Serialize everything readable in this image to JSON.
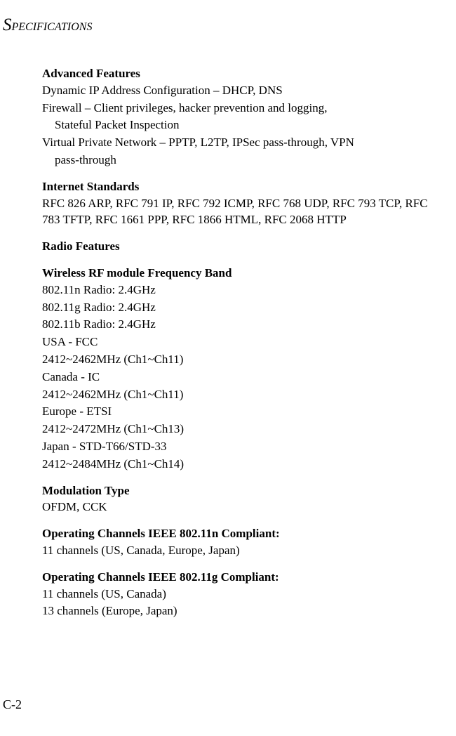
{
  "header": "PECIFICATIONS",
  "header_first": "S",
  "page_number": "C-2",
  "sections": {
    "advanced_features": {
      "heading": "Advanced Features",
      "line1": "Dynamic IP Address Configuration – DHCP, DNS",
      "line2": "Firewall – Client privileges, hacker prevention and logging,",
      "line2b": "Stateful Packet Inspection",
      "line3": "Virtual Private Network – PPTP, L2TP, IPSec pass-through, VPN",
      "line3b": "pass-through"
    },
    "internet_standards": {
      "heading": "Internet Standards",
      "line1": "RFC 826 ARP, RFC 791 IP, RFC 792 ICMP, RFC 768 UDP, RFC 793 TCP, RFC 783 TFTP, RFC 1661 PPP, RFC 1866 HTML, RFC 2068 HTTP"
    },
    "radio_features": {
      "heading": "Radio Features"
    },
    "wireless_band": {
      "heading": "Wireless RF module Frequency Band",
      "l1": "802.11n Radio: 2.4GHz",
      "l2": "802.11g Radio: 2.4GHz",
      "l3": "802.11b Radio: 2.4GHz",
      "l4": "USA - FCC",
      "l5": "2412~2462MHz (Ch1~Ch11)",
      "l6": "Canada - IC",
      "l7": "2412~2462MHz (Ch1~Ch11)",
      "l8": "Europe - ETSI",
      "l9": "2412~2472MHz (Ch1~Ch13)",
      "l10": "Japan - STD-T66/STD-33",
      "l11": "2412~2484MHz (Ch1~Ch14)"
    },
    "modulation": {
      "heading": "Modulation Type",
      "line1": "OFDM, CCK"
    },
    "channels_n": {
      "heading": "Operating Channels IEEE 802.11n Compliant:",
      "line1": "11 channels (US, Canada, Europe, Japan)"
    },
    "channels_g": {
      "heading": "Operating Channels IEEE 802.11g Compliant:",
      "line1": "11 channels (US, Canada)",
      "line2": "13 channels (Europe, Japan)"
    }
  }
}
